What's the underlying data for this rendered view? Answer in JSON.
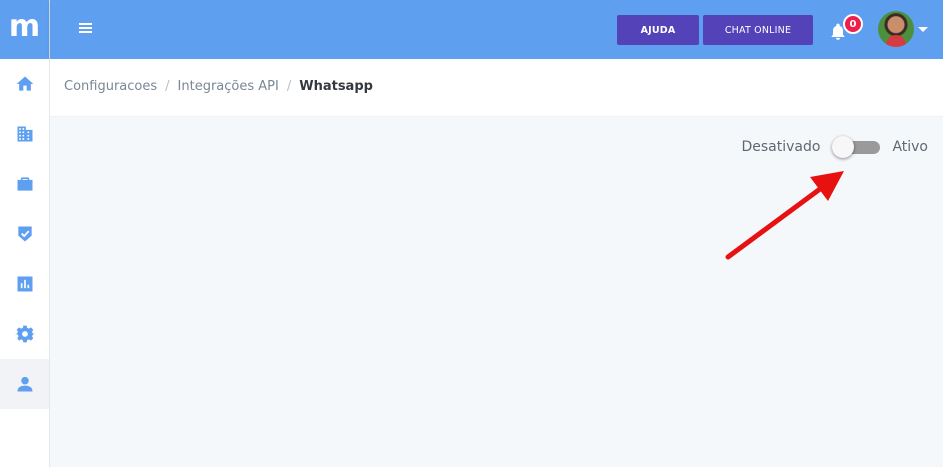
{
  "sidebar": {
    "logo_letter": "m",
    "items": [
      {
        "name": "home-icon"
      },
      {
        "name": "building-icon"
      },
      {
        "name": "briefcase-icon"
      },
      {
        "name": "shield-check-icon"
      },
      {
        "name": "bar-chart-icon"
      },
      {
        "name": "gear-icon"
      },
      {
        "name": "user-icon"
      }
    ]
  },
  "header": {
    "help_label": "AJUDA",
    "chat_label": "CHAT ONLINE",
    "notification_count": "0"
  },
  "breadcrumb": {
    "items": [
      "Configuracoes",
      "Integrações API"
    ],
    "current": "Whatsapp"
  },
  "toggle": {
    "off_label": "Desativado",
    "on_label": "Ativo",
    "state": "off"
  },
  "colors": {
    "primary": "#5e9ff0",
    "button": "#5442b8",
    "badge": "#ef1f4b",
    "arrow": "#e81111"
  }
}
